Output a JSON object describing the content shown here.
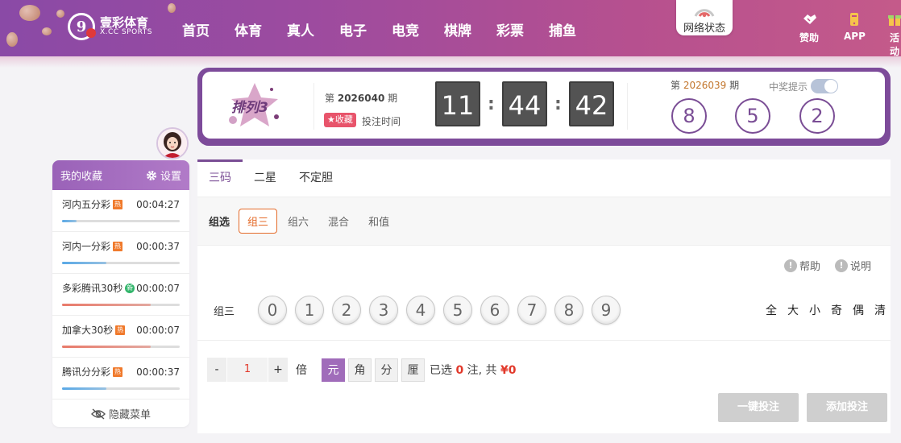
{
  "header": {
    "logo_cn": "壹彩体育",
    "logo_en": "X.CC SPORTS",
    "logo_mark": "9",
    "nav": [
      "首页",
      "体育",
      "真人",
      "电子",
      "电竞",
      "棋牌",
      "彩票",
      "捕鱼"
    ],
    "net_status": "网络状态",
    "sponsor": "赞助",
    "app": "APP",
    "activity": "活动"
  },
  "sidebar": {
    "title": "我的收藏",
    "settings": "设置",
    "items": [
      {
        "name": "河内五分彩",
        "badge": "热",
        "time": "00:04:27",
        "progress": 0.12,
        "color": "#5aa9e6"
      },
      {
        "name": "河内一分彩",
        "badge": "热",
        "time": "00:00:37",
        "progress": 0.38,
        "color": "#5aa9e6"
      },
      {
        "name": "多彩腾讯30秒",
        "badge": "新",
        "time": "00:00:07",
        "progress": 0.75,
        "color": "#e97a6a"
      },
      {
        "name": "加拿大30秒",
        "badge": "热",
        "time": "00:00:07",
        "progress": 0.75,
        "color": "#e97a6a"
      },
      {
        "name": "腾讯分分彩",
        "badge": "热",
        "time": "00:00:37",
        "progress": 0.38,
        "color": "#5aa9e6"
      }
    ],
    "hide_menu": "隐藏菜单"
  },
  "draw": {
    "lottery_name": "排列3",
    "issue_prefix": "第",
    "issue": "2026040",
    "issue_suffix": "期",
    "favorite": "收藏",
    "bet_time": "投注时间",
    "countdown": [
      "11",
      "44",
      "42"
    ],
    "prev_prefix": "第",
    "prev_issue": "2026039",
    "prev_suffix": "期",
    "win_tip": "中奖提示",
    "results": [
      "8",
      "5",
      "2"
    ]
  },
  "bet": {
    "tabs": [
      "三码",
      "二星",
      "不定胆"
    ],
    "sub_label": "组选",
    "sub_options": [
      "组三",
      "组六",
      "混合",
      "和值"
    ],
    "help": "帮助",
    "explain": "说明",
    "row_label": "组三",
    "numbers": [
      "0",
      "1",
      "2",
      "3",
      "4",
      "5",
      "6",
      "7",
      "8",
      "9"
    ],
    "quick_picks": [
      "全",
      "大",
      "小",
      "奇",
      "偶",
      "清"
    ],
    "minus": "-",
    "multiplier": "1",
    "plus": "+",
    "bei": "倍",
    "units": [
      "元",
      "角",
      "分",
      "厘"
    ],
    "selected_prefix": "已选",
    "selected_count": "0",
    "selected_mid": "注, 共",
    "amount": "¥0",
    "one_click_bet": "一键投注",
    "add_bet": "添加投注"
  }
}
